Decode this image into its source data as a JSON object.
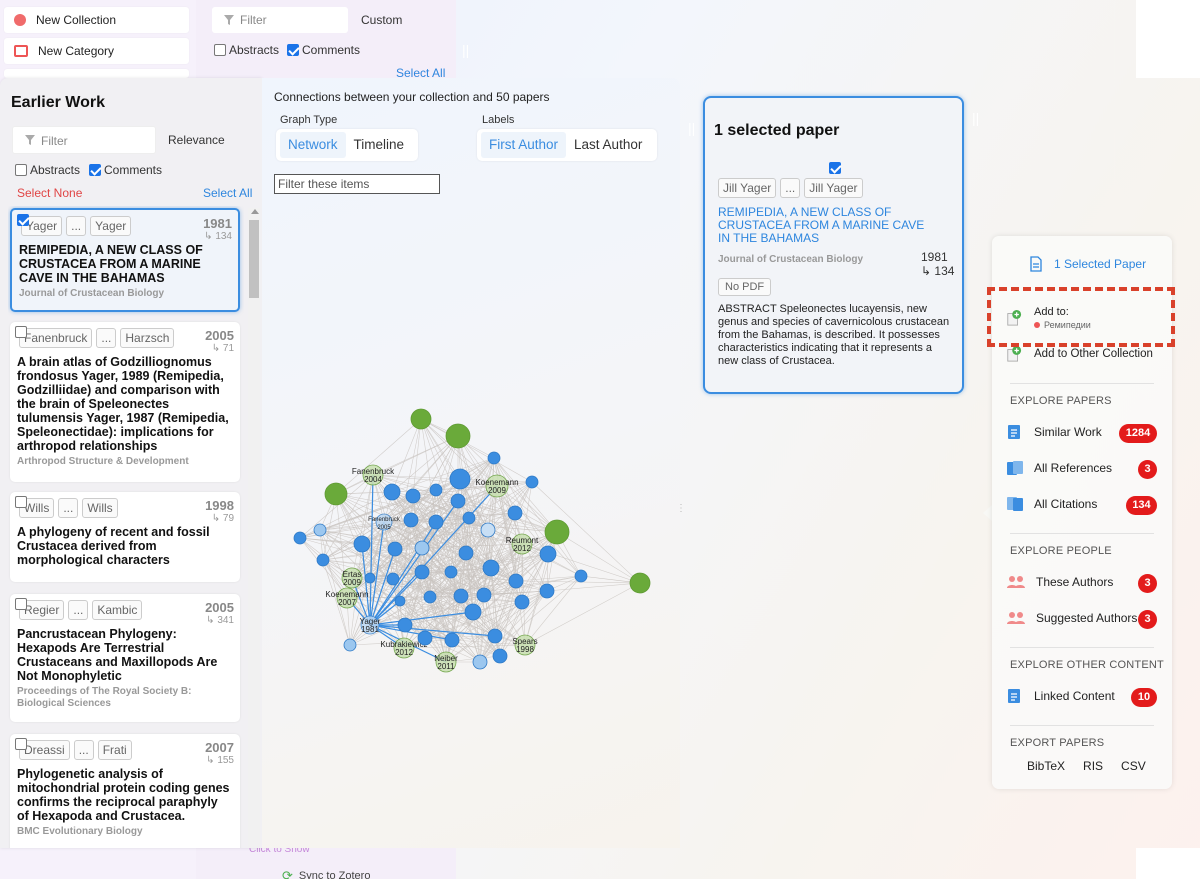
{
  "bg": {
    "new_collection": "New Collection",
    "new_category": "New Category",
    "filter_placeholder": "Filter",
    "custom": "Custom",
    "abstracts": "Abstracts",
    "comments": "Comments",
    "select_all": "Select All",
    "click_to_show": "Click to Show",
    "sync": "Sync to Zotero"
  },
  "left": {
    "title": "Earlier Work",
    "filter_placeholder": "Filter",
    "sort": "Relevance",
    "abstracts": "Abstracts",
    "comments": "Comments",
    "select_none": "Select None",
    "select_all": "Select All",
    "papers": [
      {
        "a1": "Yager",
        "dots": "...",
        "a2": "Yager",
        "year": "1981",
        "cites": "↳ 134",
        "title": "REMIPEDIA, A NEW CLASS OF CRUSTACEA FROM A MARINE CAVE IN THE BAHAMAS",
        "journal": "Journal of Crustacean Biology"
      },
      {
        "a1": "Fanenbruck",
        "dots": "...",
        "a2": "Harzsch",
        "year": "2005",
        "cites": "↳ 71",
        "title": "A brain atlas of Godzilliognomus frondosus Yager, 1989 (Remipedia, Godzilliidae) and comparison with the brain of Speleonectes tulumensis Yager, 1987 (Remipedia, Speleonectidae): implications for arthropod relationships",
        "journal": "Arthropod Structure & Development"
      },
      {
        "a1": "Wills",
        "dots": "...",
        "a2": "Wills",
        "year": "1998",
        "cites": "↳ 79",
        "title": "A phylogeny of recent and fossil Crustacea derived from morphological characters",
        "journal": ""
      },
      {
        "a1": "Regier",
        "dots": "...",
        "a2": "Kambic",
        "year": "2005",
        "cites": "↳ 341",
        "title": "Pancrustacean Phylogeny: Hexapods Are Terrestrial Crustaceans and Maxillopods Are Not Monophyletic",
        "journal": "Proceedings of The Royal Society B: Biological Sciences"
      },
      {
        "a1": "Dreassi",
        "dots": "...",
        "a2": "Frati",
        "year": "2007",
        "cites": "↳ 155",
        "title": "Phylogenetic analysis of mitochondrial protein coding genes confirms the reciprocal paraphyly of Hexapoda and Crustacea.",
        "journal": "BMC Evolutionary Biology"
      }
    ]
  },
  "graph": {
    "heading": "Connections between your collection and 50 papers",
    "graph_type_label": "Graph Type",
    "network": "Network",
    "timeline": "Timeline",
    "labels_label": "Labels",
    "first_author": "First Author",
    "last_author": "Last Author",
    "filter_placeholder": "Filter these items",
    "node_labels": [
      {
        "name": "Fanenbruck",
        "year": "2004"
      },
      {
        "name": "Koenemann",
        "year": "2009"
      },
      {
        "name": "Fanenbruck",
        "year": "2005"
      },
      {
        "name": "Reumont",
        "year": "2012"
      },
      {
        "name": "Ertas",
        "year": "2009"
      },
      {
        "name": "Koenemann",
        "year": "2007"
      },
      {
        "name": "Yager",
        "year": "1981"
      },
      {
        "name": "Kubrakiewicz",
        "year": "2012"
      },
      {
        "name": "Spears",
        "year": "1998"
      },
      {
        "name": "Neiber",
        "year": "2011"
      }
    ]
  },
  "selected": {
    "title": "1 selected paper",
    "a1": "Jill Yager",
    "dots": "...",
    "a2": "Jill Yager",
    "paper_title": "REMIPEDIA, A NEW CLASS OF CRUSTACEA FROM A MARINE CAVE IN THE BAHAMAS",
    "journal": "Journal of Crustacean Biology",
    "year": "1981",
    "cites": "↳ 134",
    "no_pdf": "No PDF",
    "abstract": "ABSTRACT Speleonectes lucayensis, new genus and species of cavernicolous crustacean from the Bahamas, is described. It possesses characteristics indicating that it represents a new class of Crustacea."
  },
  "menu": {
    "selected_papers": "1 Selected Paper",
    "add_to": "Add to:",
    "collection_name": "Ремипедии",
    "add_other": "Add to Other Collection",
    "explore_papers": "EXPLORE PAPERS",
    "similar_work": "Similar Work",
    "similar_count": "1284",
    "all_references": "All References",
    "references_count": "3",
    "all_citations": "All Citations",
    "citations_count": "134",
    "explore_people": "EXPLORE PEOPLE",
    "these_authors": "These Authors",
    "these_authors_count": "3",
    "suggested_authors": "Suggested Authors",
    "suggested_count": "3",
    "explore_other": "EXPLORE OTHER CONTENT",
    "linked_content": "Linked Content",
    "linked_count": "10",
    "export_papers": "EXPORT PAPERS",
    "bibtex": "BibTeX",
    "ris": "RIS",
    "csv": "CSV"
  },
  "colors": {
    "accent": "#3b8de0",
    "danger": "#e31b1b",
    "node_green": "#6aaa3a",
    "node_blue": "#3b8de0",
    "highlight_box": "#d9412b"
  }
}
